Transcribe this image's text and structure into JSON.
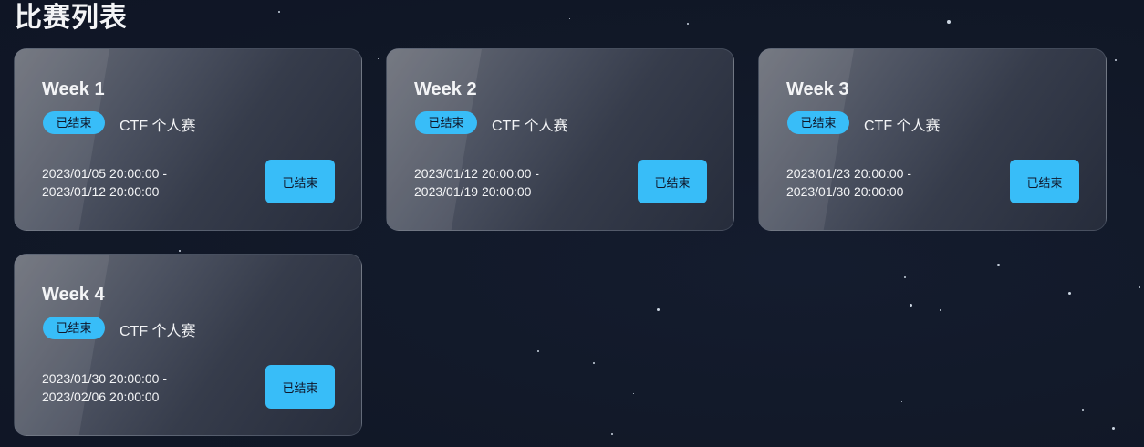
{
  "page": {
    "title": "比赛列表"
  },
  "competitions": [
    {
      "title": "Week 1",
      "status": "已结束",
      "type": "CTF 个人赛",
      "start": "2023/01/05 20:00:00 -",
      "end": "2023/01/12 20:00:00",
      "action": "已结束"
    },
    {
      "title": "Week 2",
      "status": "已结束",
      "type": "CTF 个人赛",
      "start": "2023/01/12 20:00:00 -",
      "end": "2023/01/19 20:00:00",
      "action": "已结束"
    },
    {
      "title": "Week 3",
      "status": "已结束",
      "type": "CTF 个人赛",
      "start": "2023/01/23 20:00:00 -",
      "end": "2023/01/30 20:00:00",
      "action": "已结束"
    },
    {
      "title": "Week 4",
      "status": "已结束",
      "type": "CTF 个人赛",
      "start": "2023/01/30 20:00:00 -",
      "end": "2023/02/06 20:00:00",
      "action": "已结束"
    }
  ],
  "colors": {
    "background": "#111827",
    "accent": "#38bdf8",
    "text": "#f3f4f6"
  }
}
